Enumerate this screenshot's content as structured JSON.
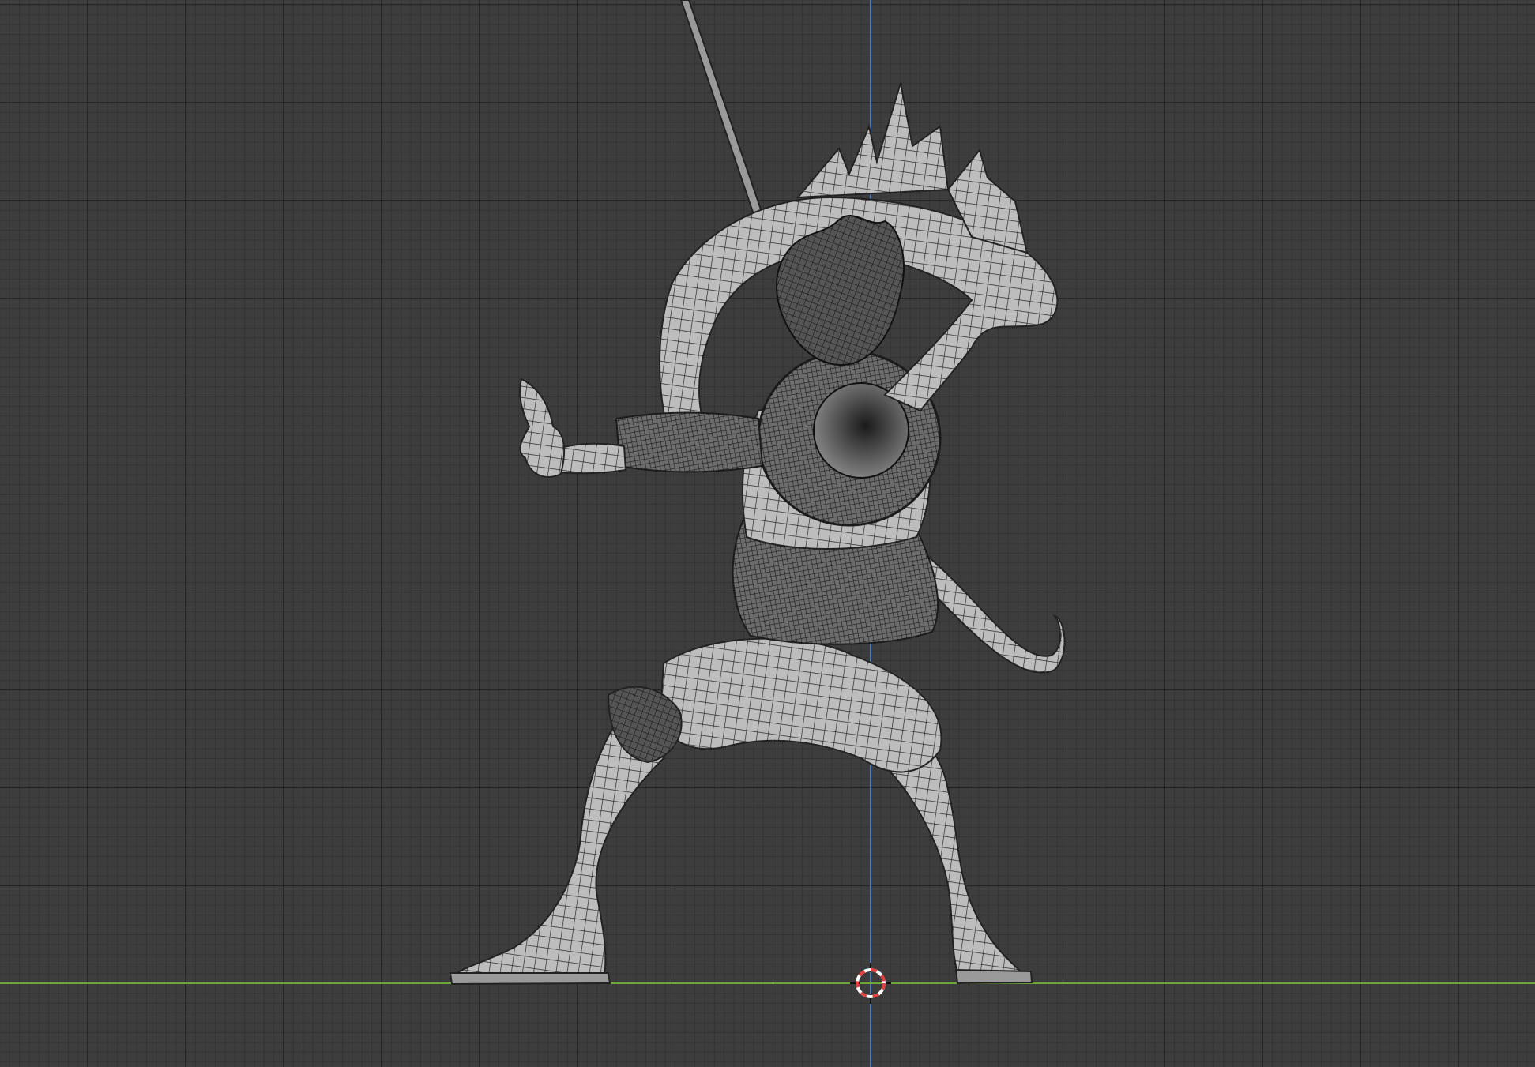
{
  "viewport": {
    "title": "",
    "colors": {
      "background": "#3d3d3d",
      "x_axis": "#6ea83a",
      "z_axis": "#4f7bbf",
      "mesh_fill": "#b9b9b9",
      "mesh_wire": "#2b2b2b",
      "cursor_red": "#e04040",
      "cursor_white": "#ffffff"
    },
    "icons": [
      "3d-cursor-icon"
    ],
    "object": "character-wireframe-mesh"
  }
}
